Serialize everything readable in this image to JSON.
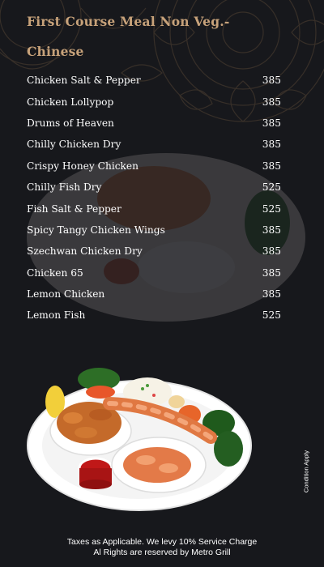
{
  "menu": {
    "heading_line1": "First Course Meal Non Veg.-",
    "heading_line2": "Chinese",
    "items": [
      {
        "name": "Chicken Salt & Pepper",
        "price": "385"
      },
      {
        "name": "Chicken Lollypop",
        "price": "385"
      },
      {
        "name": "Drums of Heaven",
        "price": "385"
      },
      {
        "name": "Chilly Chicken Dry",
        "price": "385"
      },
      {
        "name": "Crispy Honey Chicken",
        "price": "385"
      },
      {
        "name": "Chilly Fish Dry",
        "price": "525"
      },
      {
        "name": "Fish Salt & Pepper",
        "price": "525"
      },
      {
        "name": "Spicy Tangy Chicken Wings",
        "price": "385"
      },
      {
        "name": "Szechwan Chicken Dry",
        "price": "385"
      },
      {
        "name": "Chicken 65",
        "price": "385"
      },
      {
        "name": "Lemon Chicken",
        "price": "385"
      },
      {
        "name": "Lemon Fish",
        "price": "525"
      }
    ]
  },
  "side_note": "Condition Apply",
  "footer": {
    "line1": "Taxes as Applicable. We levy 10% Service Charge",
    "line2": "Al Rights are reserved by Metro Grill"
  },
  "colors": {
    "background": "#17181c",
    "heading": "#c7a27a",
    "text": "#ffffff"
  }
}
